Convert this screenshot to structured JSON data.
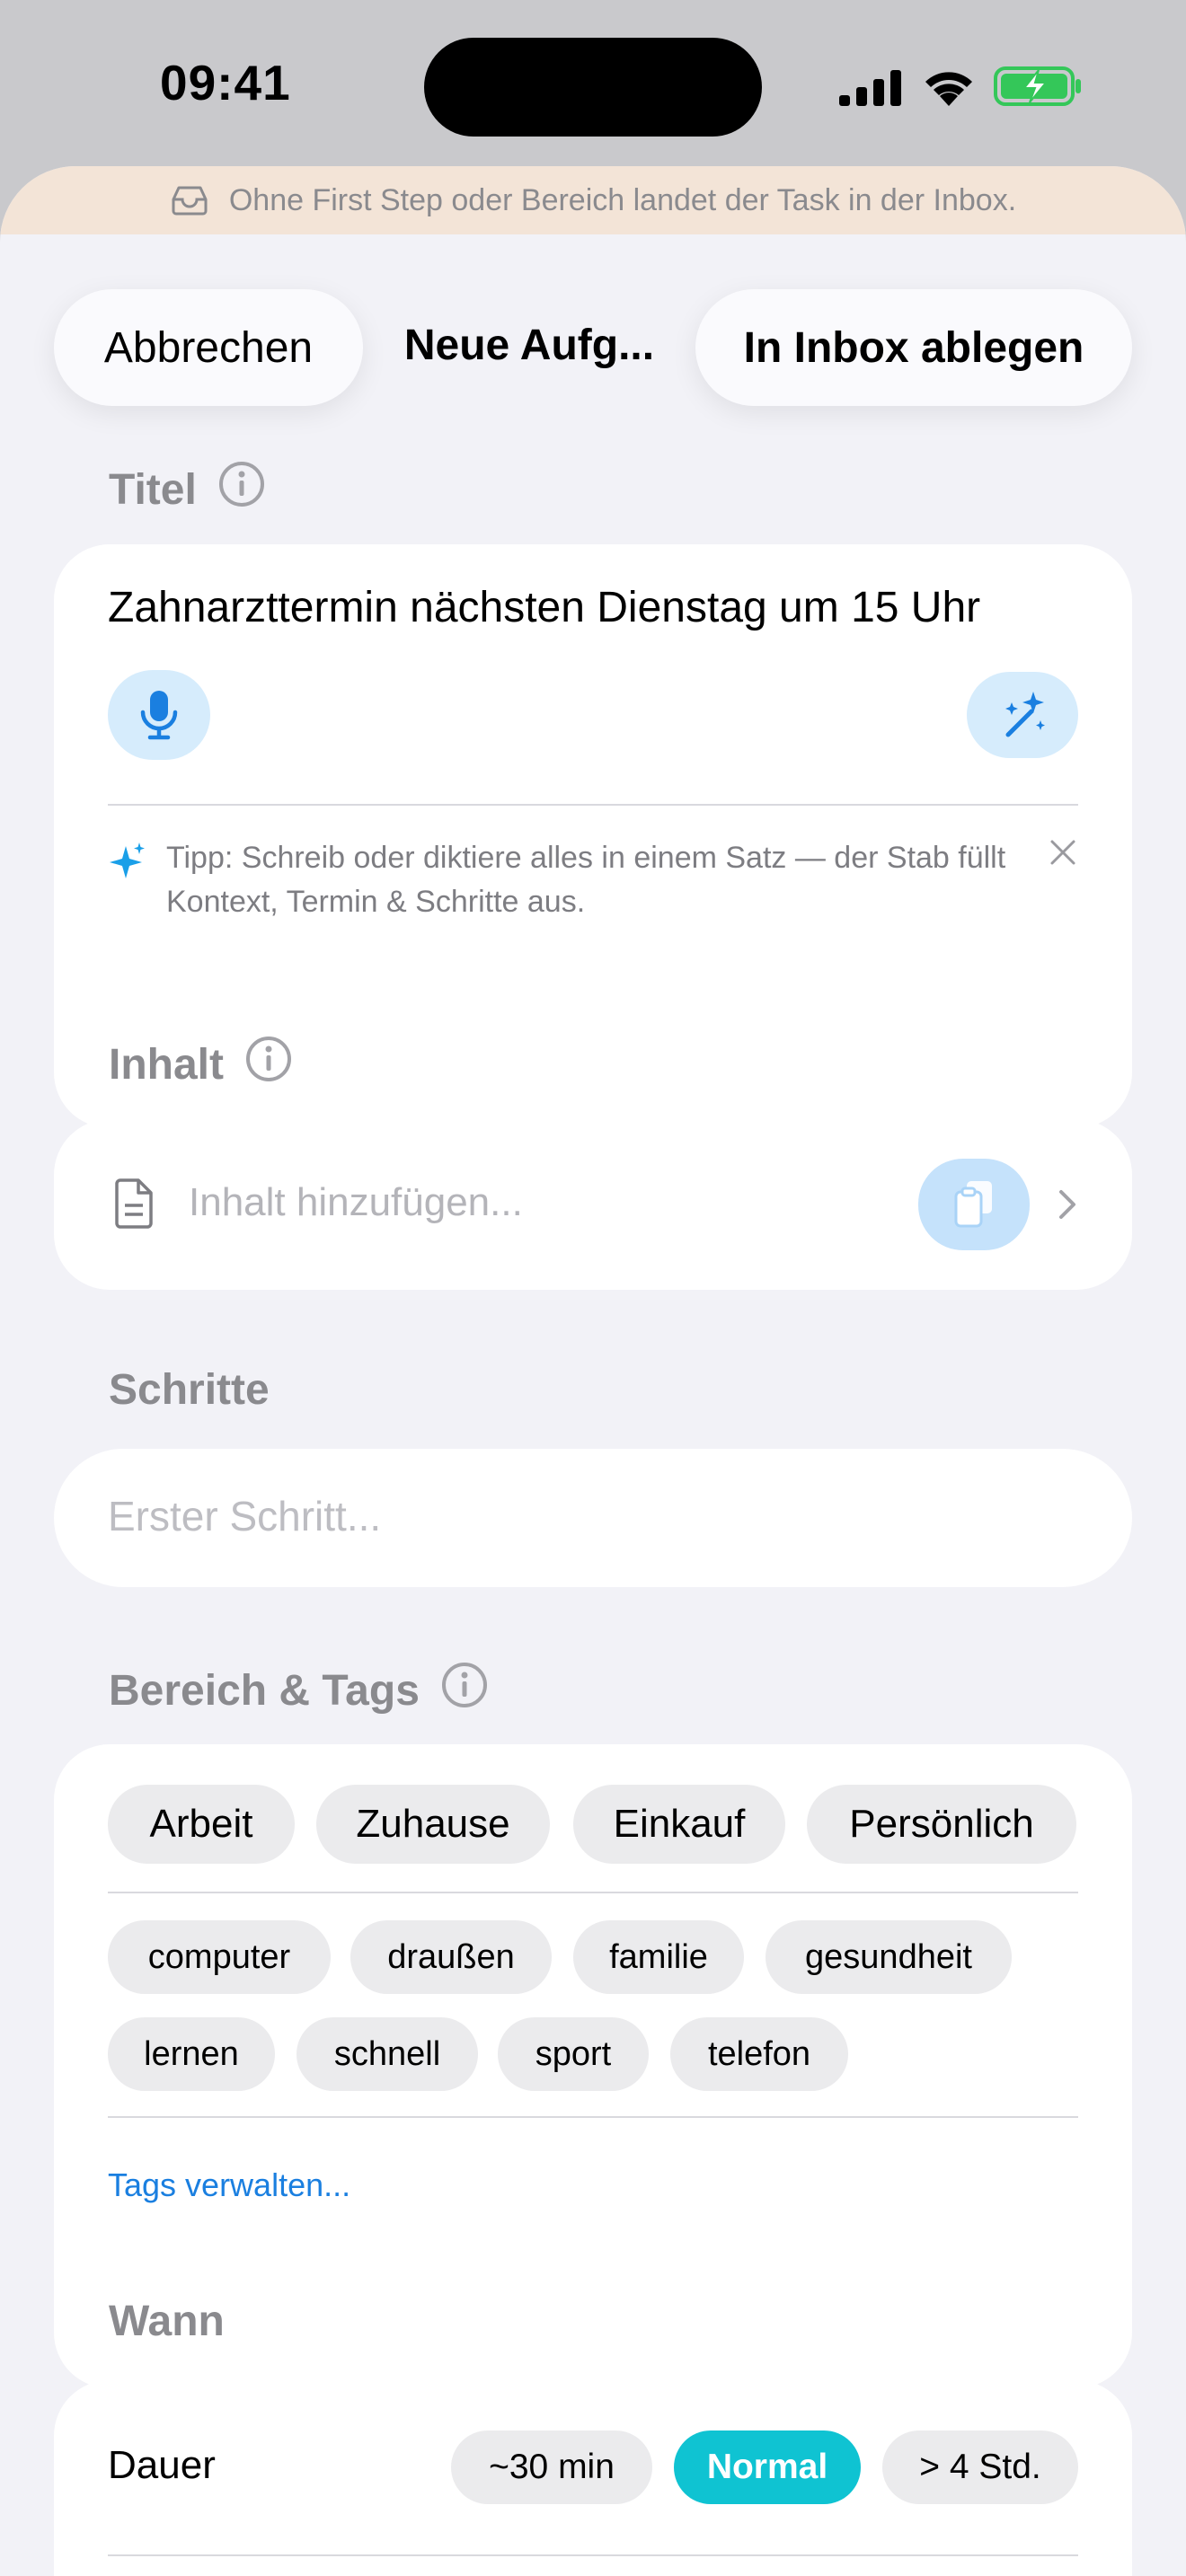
{
  "status_bar": {
    "time": "09:41"
  },
  "banner": {
    "text": "Ohne First Step oder Bereich landet der Task in der Inbox.",
    "icon": "inbox-tray-icon"
  },
  "nav": {
    "cancel_label": "Abbrechen",
    "title": "Neue Aufg...",
    "primary_label": "In Inbox ablegen"
  },
  "titel": {
    "label": "Titel",
    "value": "Zahnarzttermin nächsten Dienstag um 15 Uhr",
    "tip": "Tipp: Schreib oder diktiere alles in einem Satz — der Stab füllt Kontext, Termin & Schritte aus."
  },
  "inhalt": {
    "label": "Inhalt",
    "placeholder": "Inhalt hinzufügen..."
  },
  "schritte": {
    "label": "Schritte",
    "placeholder": "Erster Schritt..."
  },
  "bereich": {
    "label": "Bereich & Tags",
    "areas": [
      "Arbeit",
      "Zuhause",
      "Einkauf",
      "Persönlich"
    ],
    "tags": [
      "computer",
      "draußen",
      "familie",
      "gesundheit",
      "lernen",
      "schnell",
      "sport",
      "telefon"
    ],
    "manage_link": "Tags verwalten..."
  },
  "wann": {
    "label": "Wann",
    "dauer_label": "Dauer",
    "options": [
      "~30 min",
      "Normal",
      "> 4 Std."
    ],
    "selected": "Normal"
  },
  "colors": {
    "accent_blue": "#1a7fe0",
    "selected_teal": "#0fc3d2",
    "banner_bg": "#f3e4d7",
    "battery_green": "#34c759"
  }
}
